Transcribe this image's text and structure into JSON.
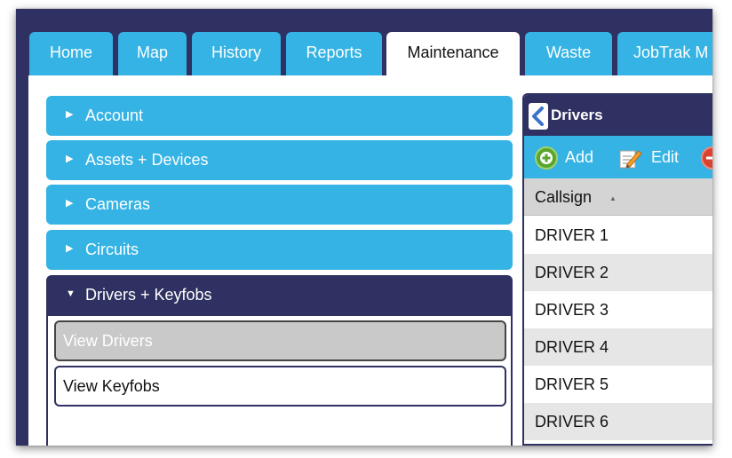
{
  "tabs": [
    {
      "label": "Home",
      "active": false
    },
    {
      "label": "Map",
      "active": false
    },
    {
      "label": "History",
      "active": false
    },
    {
      "label": "Reports",
      "active": false
    },
    {
      "label": "Maintenance",
      "active": true
    },
    {
      "label": "Waste",
      "active": false
    },
    {
      "label": "JobTrak M",
      "active": false
    }
  ],
  "accordion": {
    "sections": [
      {
        "label": "Account",
        "expanded": false
      },
      {
        "label": "Assets + Devices",
        "expanded": false
      },
      {
        "label": "Cameras",
        "expanded": false
      },
      {
        "label": "Circuits",
        "expanded": false
      },
      {
        "label": "Drivers + Keyfobs",
        "expanded": true
      }
    ],
    "items": [
      {
        "label": "View Drivers",
        "selected": true
      },
      {
        "label": "View Keyfobs",
        "selected": false
      }
    ]
  },
  "drivers_panel": {
    "title": "Drivers",
    "toolbar": {
      "add_label": "Add",
      "edit_label": "Edit"
    },
    "column_header": "Callsign",
    "rows": [
      "DRIVER 1",
      "DRIVER 2",
      "DRIVER 3",
      "DRIVER 4",
      "DRIVER 5",
      "DRIVER 6"
    ]
  },
  "colors": {
    "navy": "#2e3161",
    "accent_blue": "#34b3e4",
    "selected_gray": "#c9c9c9",
    "row_alt": "#e6e6e6"
  },
  "icons": {
    "collapsed_section": "caret-right-icon",
    "expanded_section": "caret-down-icon",
    "back": "chevron-left-icon",
    "add": "add-circle-icon",
    "edit": "edit-pencil-icon",
    "delete": "delete-circle-icon"
  }
}
